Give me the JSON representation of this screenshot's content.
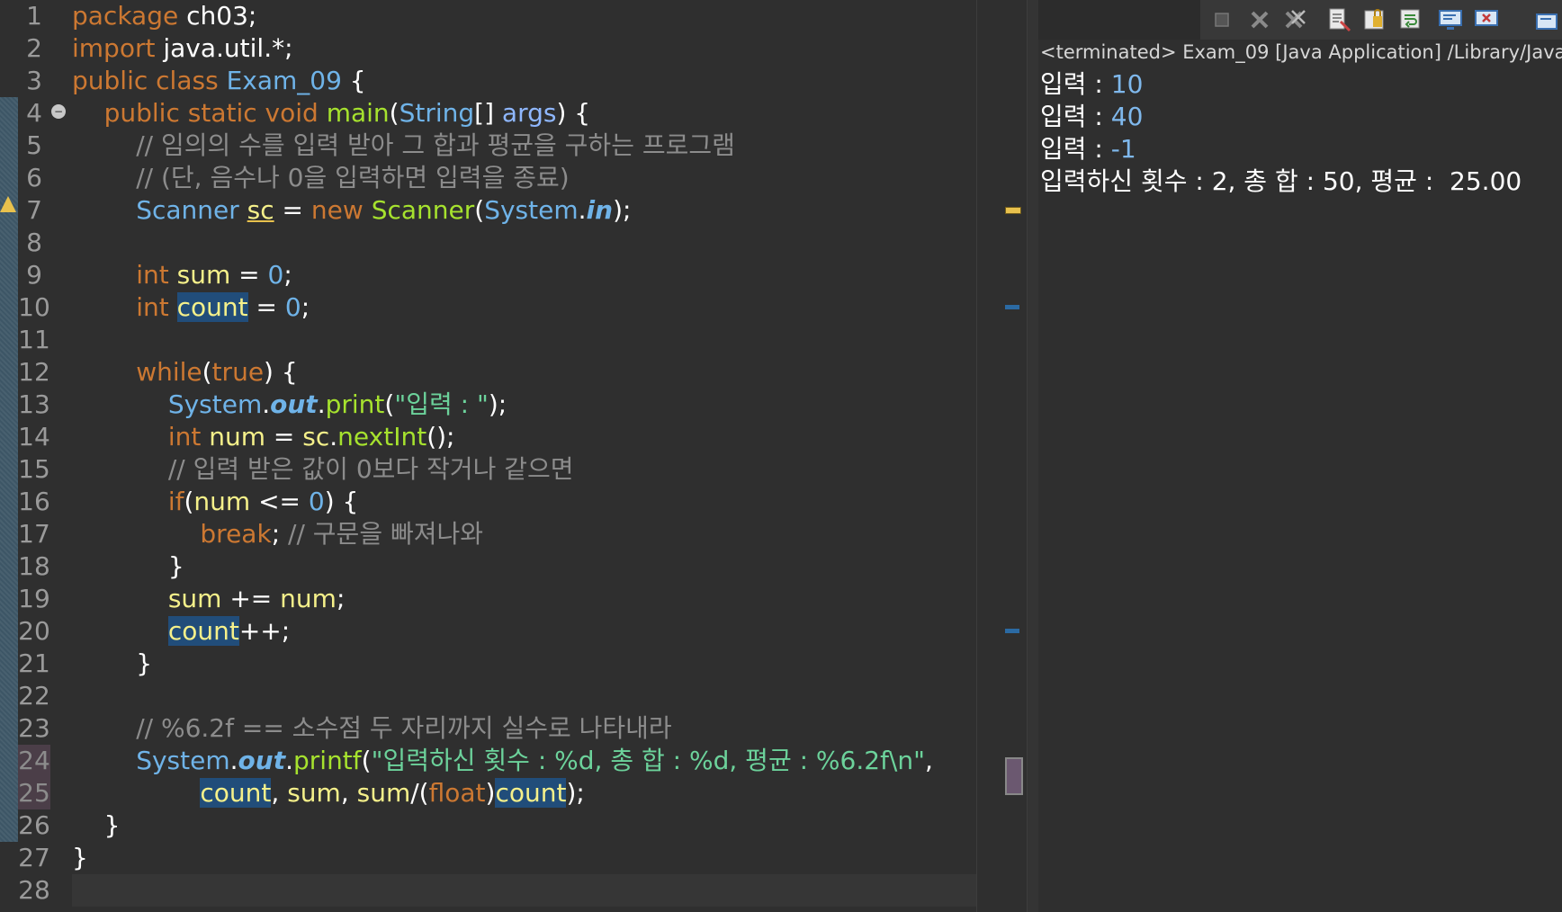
{
  "editor": {
    "line_numbers": [
      "1",
      "2",
      "3",
      "4",
      "5",
      "6",
      "7",
      "8",
      "9",
      "10",
      "11",
      "12",
      "13",
      "14",
      "15",
      "16",
      "17",
      "18",
      "19",
      "20",
      "21",
      "22",
      "23",
      "24",
      "25",
      "26",
      "27",
      "28"
    ],
    "fold_marker": "−",
    "code": {
      "l1_kw": "package",
      "l1_rest": " ch03;",
      "l2_kw": "import",
      "l2_rest": " java.util.*;",
      "l3_kw": "public class",
      "l3_cls": "Exam_09",
      "l3_rest": " {",
      "l4_kw": "public static void",
      "l4_fn": "main",
      "l4_p1": "(",
      "l4_type": "String",
      "l4_p2": "[] ",
      "l4_args": "args",
      "l4_p3": ") {",
      "l5_comment": "// 임의의 수를 입력 받아 그 합과 평균을 구하는 프로그램",
      "l6_comment": "// (단, 음수나 0을 입력하면 입력을 종료)",
      "l7_type": "Scanner",
      "l7_var": "sc",
      "l7_eq": " = ",
      "l7_new": "new",
      "l7_ctor": "Scanner",
      "l7_p1": "(",
      "l7_sys": "System",
      "l7_dot": ".",
      "l7_in": "in",
      "l7_p2": ");",
      "l9_kw": "int",
      "l9_var": "sum",
      "l9_eq": " = ",
      "l9_num": "0",
      "l9_end": ";",
      "l10_kw": "int",
      "l10_var": "count",
      "l10_eq": " = ",
      "l10_num": "0",
      "l10_end": ";",
      "l12_kw": "while",
      "l12_p1": "(",
      "l12_true": "true",
      "l12_p2": ") {",
      "l13_sys": "System",
      "l13_dot": ".",
      "l13_out": "out",
      "l13_dot2": ".",
      "l13_fn": "print",
      "l13_p1": "(",
      "l13_str": "\"입력 : \"",
      "l13_p2": ");",
      "l14_kw": "int",
      "l14_var": "num",
      "l14_eq": " = ",
      "l14_sc": "sc",
      "l14_dot": ".",
      "l14_fn": "nextInt",
      "l14_p": "();",
      "l15_comment": "// 입력 받은 값이 0보다 작거나 같으면",
      "l16_kw": "if",
      "l16_p1": "(",
      "l16_var": "num",
      "l16_op": " <= ",
      "l16_num": "0",
      "l16_p2": ") {",
      "l17_kw": "break",
      "l17_semi": "; ",
      "l17_comment": "// 구문을 빠져나와",
      "l18": "}",
      "l19_var": "sum",
      "l19_op": " += ",
      "l19_var2": "num",
      "l19_end": ";",
      "l20_var": "count",
      "l20_end": "++;",
      "l21": "}",
      "l23_comment": "// %6.2f == 소수점 두 자리까지 실수로 나타내라",
      "l24_sys": "System",
      "l24_dot": ".",
      "l24_out": "out",
      "l24_dot2": ".",
      "l24_fn": "printf",
      "l24_p1": "(",
      "l24_str": "\"입력하신 횟수 : %d, 총 합 : %d, 평균 : %6.2f\\n\"",
      "l24_comma": ",",
      "l25_count": "count",
      "l25_c1": ", ",
      "l25_sum": "sum",
      "l25_c2": ", ",
      "l25_sum2": "sum",
      "l25_p1": "/(",
      "l25_float": "float",
      "l25_p2": ")",
      "l25_count2": "count",
      "l25_end": ");",
      "l26": "}",
      "l27": "}"
    }
  },
  "console": {
    "title": "<terminated> Exam_09 [Java Application] /Library/Java",
    "lines": [
      {
        "prompt": "입력 : ",
        "input": "10"
      },
      {
        "prompt": "입력 : ",
        "input": "40"
      },
      {
        "prompt": "입력 : ",
        "input": "-1"
      }
    ],
    "result": "입력하신 횟수 : 2, 총 합 : 50, 평균 :  25.00",
    "toolbar_icons": [
      "terminate-icon",
      "remove-launch-icon",
      "remove-all-icon",
      "clear-console-icon",
      "scroll-lock-icon",
      "word-wrap-icon",
      "show-console-icon",
      "pin-console-icon",
      "open-console-icon"
    ]
  },
  "colors": {
    "keyword": "#cc7832",
    "class": "#6fb3e8",
    "function": "#a6e22e",
    "variable": "#f5f08a",
    "string": "#6cd29b",
    "comment": "#8c8c8c",
    "occurrence_highlight": "#214d7a",
    "console_input": "#7fb8ec"
  }
}
